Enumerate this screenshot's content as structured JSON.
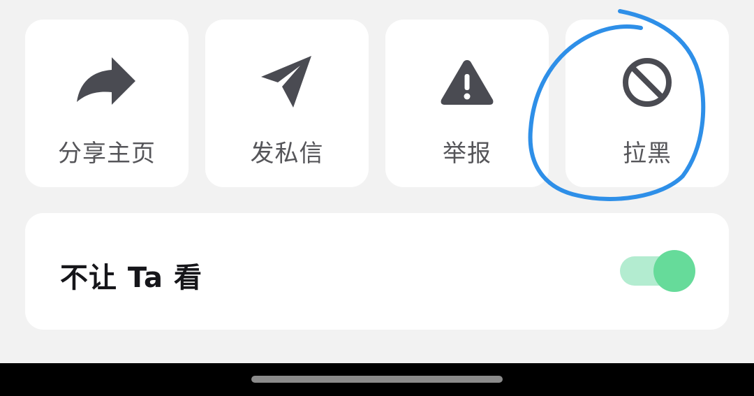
{
  "actions": [
    {
      "label": "分享主页",
      "icon": "share-arrow-icon"
    },
    {
      "label": "发私信",
      "icon": "paper-plane-icon"
    },
    {
      "label": "举报",
      "icon": "warning-triangle-icon"
    },
    {
      "label": "拉黑",
      "icon": "block-icon"
    }
  ],
  "hide_from": {
    "label": "不让 Ta 看",
    "enabled": true
  },
  "colors": {
    "background": "#f2f2f2",
    "card": "#ffffff",
    "icon": "#4a4b52",
    "label": "#555559",
    "switch_on_thumb": "#66db9a",
    "switch_on_track": "#b3ecd0",
    "annotation": "#2e8fe8"
  }
}
